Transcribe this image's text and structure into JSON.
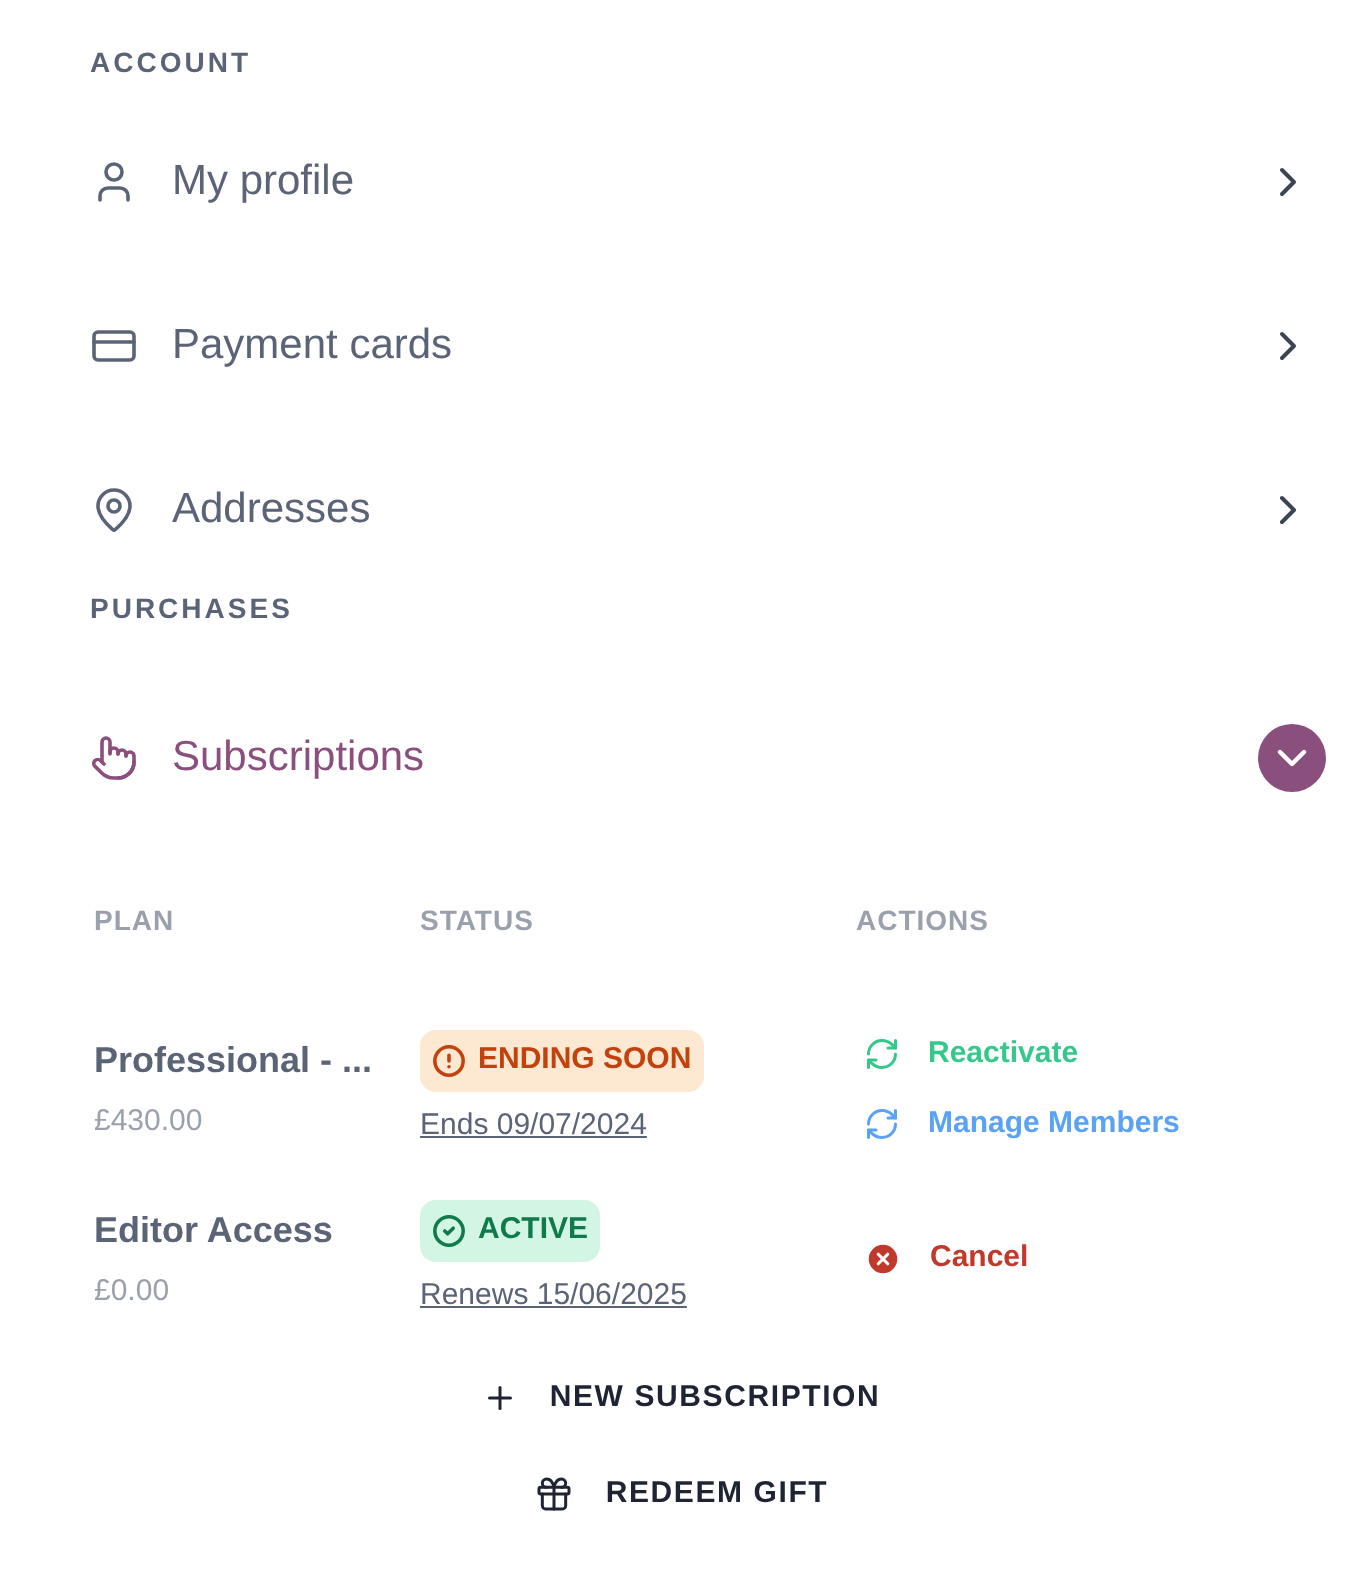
{
  "account": {
    "heading": "ACCOUNT",
    "items": [
      {
        "label": "My profile",
        "kind": "profile"
      },
      {
        "label": "Payment cards",
        "kind": "payment"
      },
      {
        "label": "Addresses",
        "kind": "address"
      }
    ]
  },
  "purchases": {
    "heading": "PURCHASES",
    "section": {
      "label": "Subscriptions",
      "expanded": true
    }
  },
  "table": {
    "columns": [
      "PLAN",
      "STATUS",
      "ACTIONS"
    ],
    "rows": [
      {
        "plan": "Professional - ...",
        "price": "£430.00",
        "status": {
          "kind": "warning",
          "label": "ENDING SOON",
          "date": "Ends 09/07/2024"
        },
        "actions": [
          {
            "kind": "reactivate",
            "label": "Reactivate"
          },
          {
            "kind": "members",
            "label": "Manage Members"
          }
        ]
      },
      {
        "plan": "Editor Access",
        "price": "£0.00",
        "status": {
          "kind": "active",
          "label": "ACTIVE",
          "date": "Renews 15/06/2025"
        },
        "actions": [
          {
            "kind": "cancel",
            "label": "Cancel"
          }
        ]
      }
    ]
  },
  "buttons": [
    {
      "kind": "new",
      "label": "NEW SUBSCRIPTION"
    },
    {
      "kind": "gift",
      "label": "REDEEM GIFT"
    }
  ]
}
